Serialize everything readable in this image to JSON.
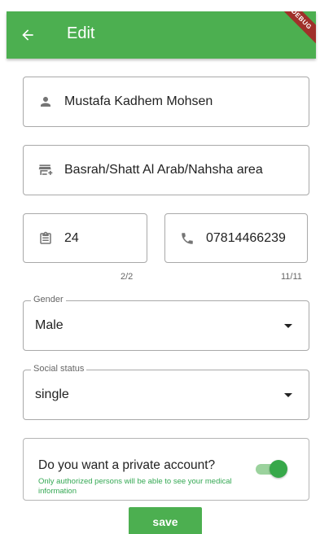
{
  "appbar": {
    "title": "Edit",
    "debug_banner": "DEBUG",
    "accent_color": "#4caf50"
  },
  "fields": {
    "name": {
      "value": "Mustafa Kadhem Mohsen",
      "icon": "person-icon"
    },
    "address": {
      "value": "Basrah/Shatt Al Arab/Nahsha area",
      "icon": "address-icon"
    },
    "age": {
      "value": "24",
      "icon": "clipboard-icon",
      "counter": "2/2"
    },
    "phone": {
      "value": "07814466239",
      "icon": "phone-icon",
      "counter": "11/11"
    }
  },
  "gender": {
    "label": "Gender",
    "value": "Male"
  },
  "social_status": {
    "label": "Social status",
    "value": "single"
  },
  "private_account": {
    "question": "Do you want a private account?",
    "description": "Only authorized persons will be able to see your medical information",
    "enabled": true
  },
  "save_label": "save"
}
